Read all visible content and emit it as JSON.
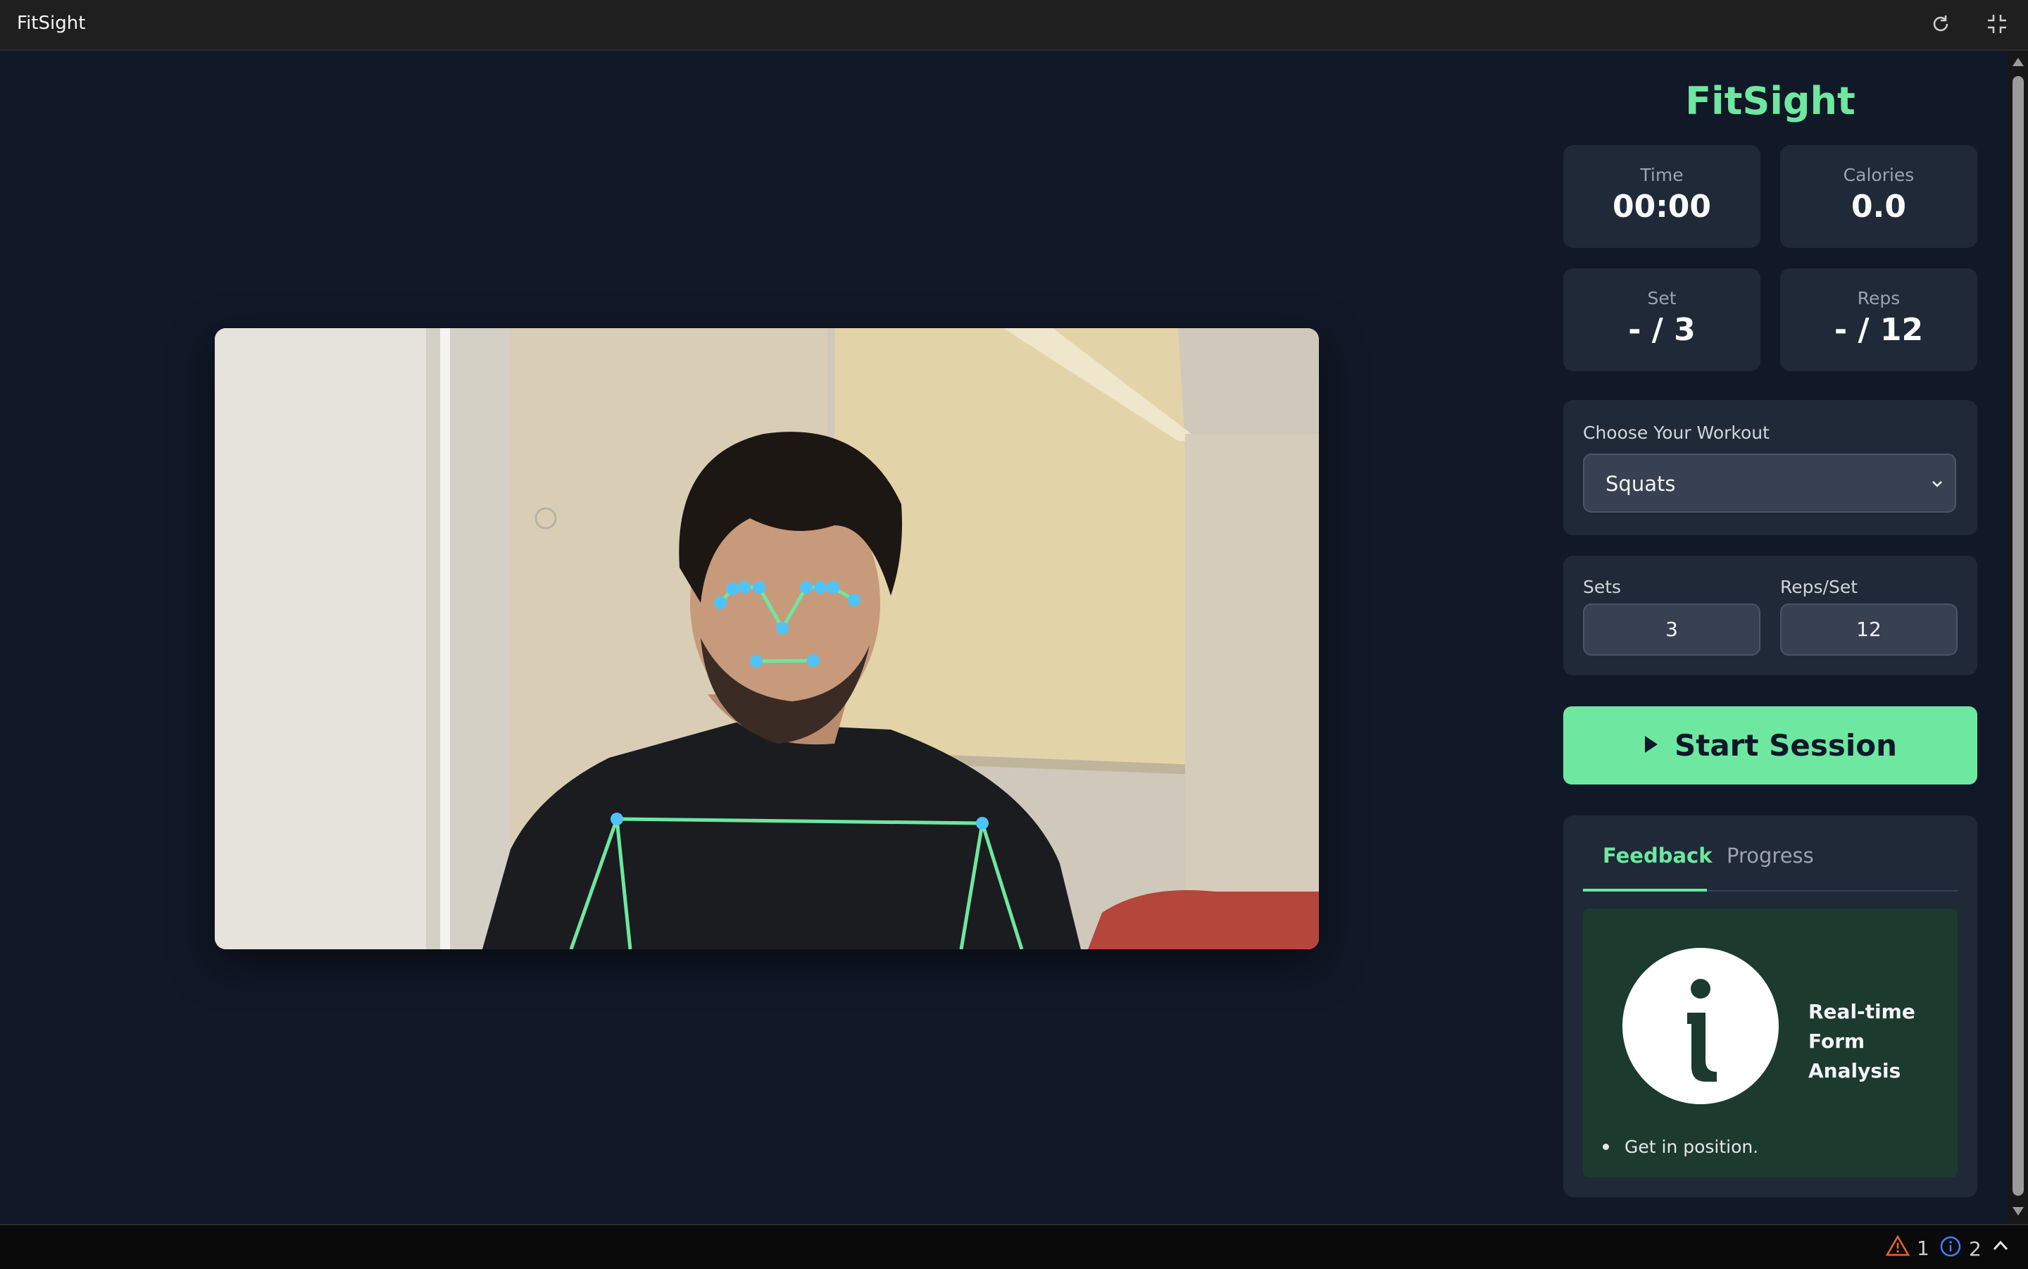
{
  "window": {
    "title": "FitSight"
  },
  "brand": "FitSight",
  "stats": {
    "time": {
      "label": "Time",
      "value": "00:00"
    },
    "calories": {
      "label": "Calories",
      "value": "0.0"
    },
    "set": {
      "label": "Set",
      "value": "- / 3"
    },
    "reps": {
      "label": "Reps",
      "value": "- / 12"
    }
  },
  "workout": {
    "label": "Choose Your Workout",
    "selected": "Squats"
  },
  "config": {
    "sets_label": "Sets",
    "sets_value": "3",
    "reps_label": "Reps/Set",
    "reps_value": "12"
  },
  "start_button": {
    "label": "Start Session"
  },
  "tabs": [
    {
      "label": "Feedback",
      "active": true
    },
    {
      "label": "Progress",
      "active": false
    }
  ],
  "feedback": {
    "title_line1": "Real-time",
    "title_line2": "Form Analysis",
    "items": [
      "Get in position."
    ]
  },
  "status_bar": {
    "warnings": "1",
    "infos": "2"
  },
  "colors": {
    "accent": "#6ee7a0",
    "background": "#111827",
    "card": "#1f2937",
    "keypoint": "#4fc3f7",
    "skeleton": "#6ee7a0"
  },
  "icons": [
    "refresh-icon",
    "collapse-icon",
    "play-icon",
    "chevron-down-icon",
    "info-icon",
    "warning-icon",
    "info-circle-icon",
    "chevron-up-icon"
  ]
}
